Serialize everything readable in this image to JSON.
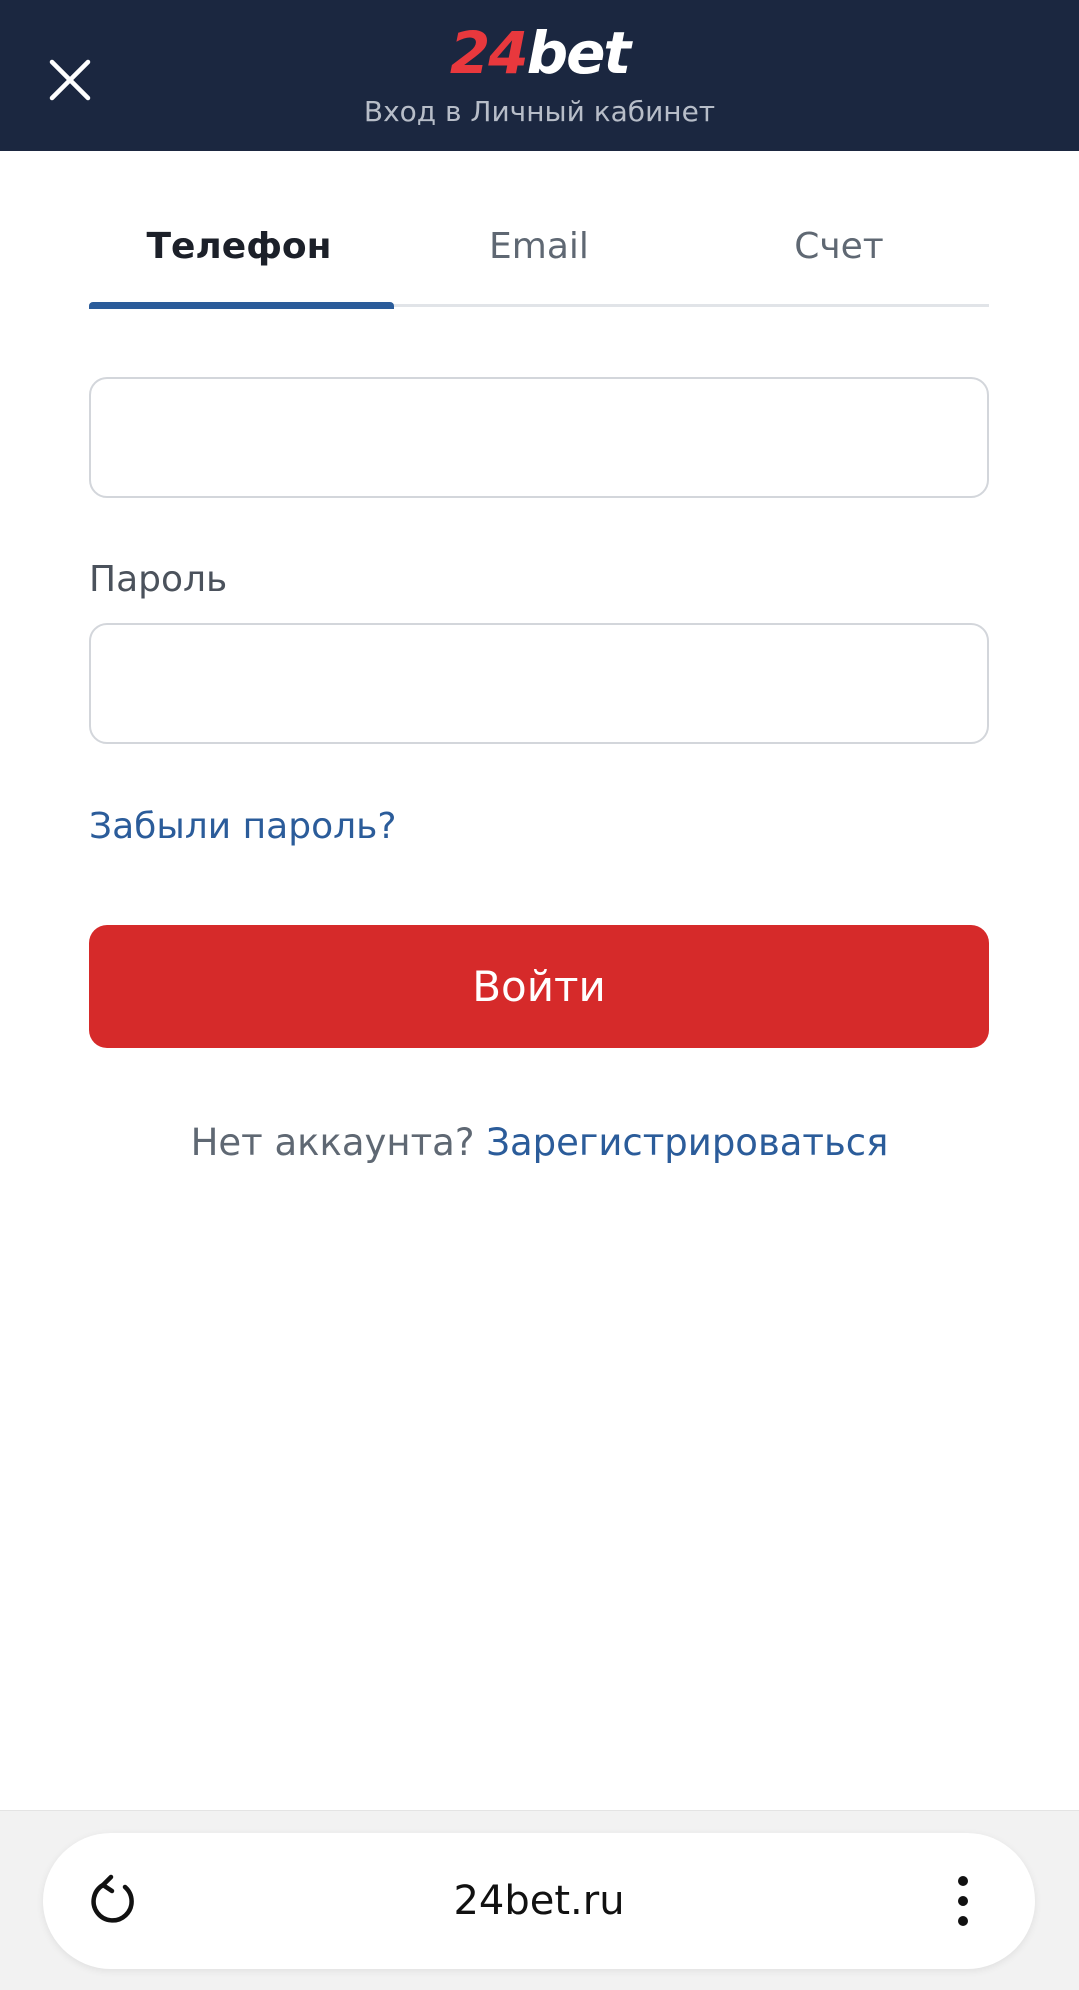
{
  "header": {
    "logo_number": "24",
    "logo_word": "bet",
    "subtitle": "Вход в Личный кабинет",
    "close_icon": "close-icon"
  },
  "tabs": [
    {
      "label": "Телефон",
      "active": true
    },
    {
      "label": "Email",
      "active": false
    },
    {
      "label": "Счет",
      "active": false
    }
  ],
  "form": {
    "phone_value": "",
    "password_label": "Пароль",
    "password_value": "",
    "forgot_label": "Забыли пароль?",
    "submit_label": "Войти",
    "no_account_text": "Нет аккаунта?",
    "register_label": "Зарегистрироваться"
  },
  "browser": {
    "url": "24bet.ru",
    "reload_icon": "reload-icon",
    "menu_icon": "more-vertical-icon"
  },
  "colors": {
    "header_bg": "#1b2740",
    "brand_red": "#e8383d",
    "button_red": "#d62a2a",
    "link_blue": "#2b5c9a"
  }
}
